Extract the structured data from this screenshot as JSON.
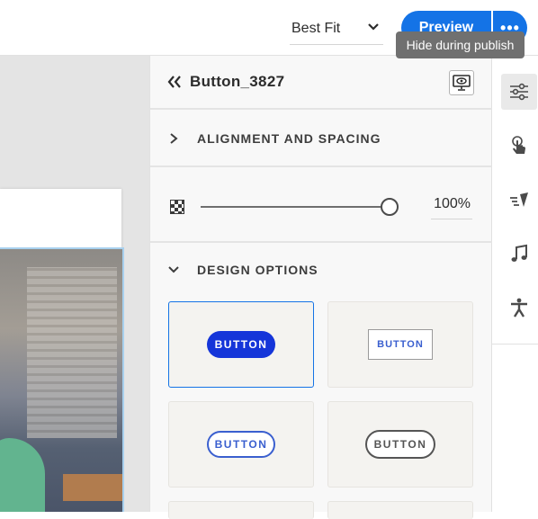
{
  "topbar": {
    "fit_value": "Best Fit",
    "preview_label": "Preview",
    "more_label": "•••",
    "tooltip": "Hide during publish"
  },
  "panel": {
    "title": "Button_3827",
    "alignment_title": "ALIGNMENT AND SPACING",
    "opacity_value": "100%",
    "opacity_level_percent": 100,
    "design_title": "DESIGN OPTIONS",
    "design_options": [
      {
        "label": "BUTTON",
        "style": "filled-pill",
        "selected": true
      },
      {
        "label": "BUTTON",
        "style": "outlined-rect",
        "selected": false
      },
      {
        "label": "BUTTON",
        "style": "outlined-pill-blue",
        "selected": false
      },
      {
        "label": "BUTTON",
        "style": "outlined-pill-gray",
        "selected": false
      }
    ]
  },
  "rail": {
    "items": [
      {
        "icon": "sliders-icon",
        "active": true
      },
      {
        "icon": "touch-interaction-icon",
        "active": false
      },
      {
        "icon": "animation-icon",
        "active": false
      },
      {
        "icon": "music-note-icon",
        "active": false
      },
      {
        "icon": "accessibility-icon",
        "active": false
      }
    ]
  },
  "colors": {
    "accent": "#1473e6",
    "button_fill": "#1535d9",
    "panel_bg": "#f8f8f8",
    "tooltip_bg": "#707070"
  }
}
